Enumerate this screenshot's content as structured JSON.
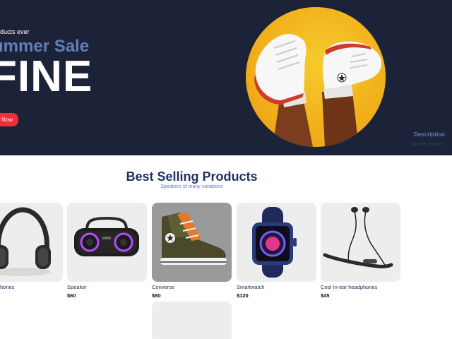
{
  "hero": {
    "subtitle": "roducts ever",
    "mid_title": "ummer Sale",
    "large_title": "FINE",
    "shop_button": "Now",
    "description_title": "Description",
    "description_text": "On the market"
  },
  "section": {
    "title": "Best Selling Products",
    "subtitle": "Speakers of many variations"
  },
  "products": [
    {
      "name": "hones",
      "price": "",
      "icon": "headphones-icon"
    },
    {
      "name": "Speaker",
      "price": "$60",
      "icon": "speaker-icon"
    },
    {
      "name": "Converse",
      "price": "$80",
      "icon": "sneaker-icon"
    },
    {
      "name": "Smartwatch",
      "price": "$120",
      "icon": "smartwatch-icon"
    },
    {
      "name": "Cool In-ear headphones",
      "price": "$45",
      "icon": "earphones-icon"
    }
  ],
  "colors": {
    "hero_bg": "#1c2238",
    "accent_blue": "#5f7fb8",
    "button_red": "#f42c37",
    "title_navy": "#1f3260",
    "hero_circle": "#f2b11c"
  }
}
